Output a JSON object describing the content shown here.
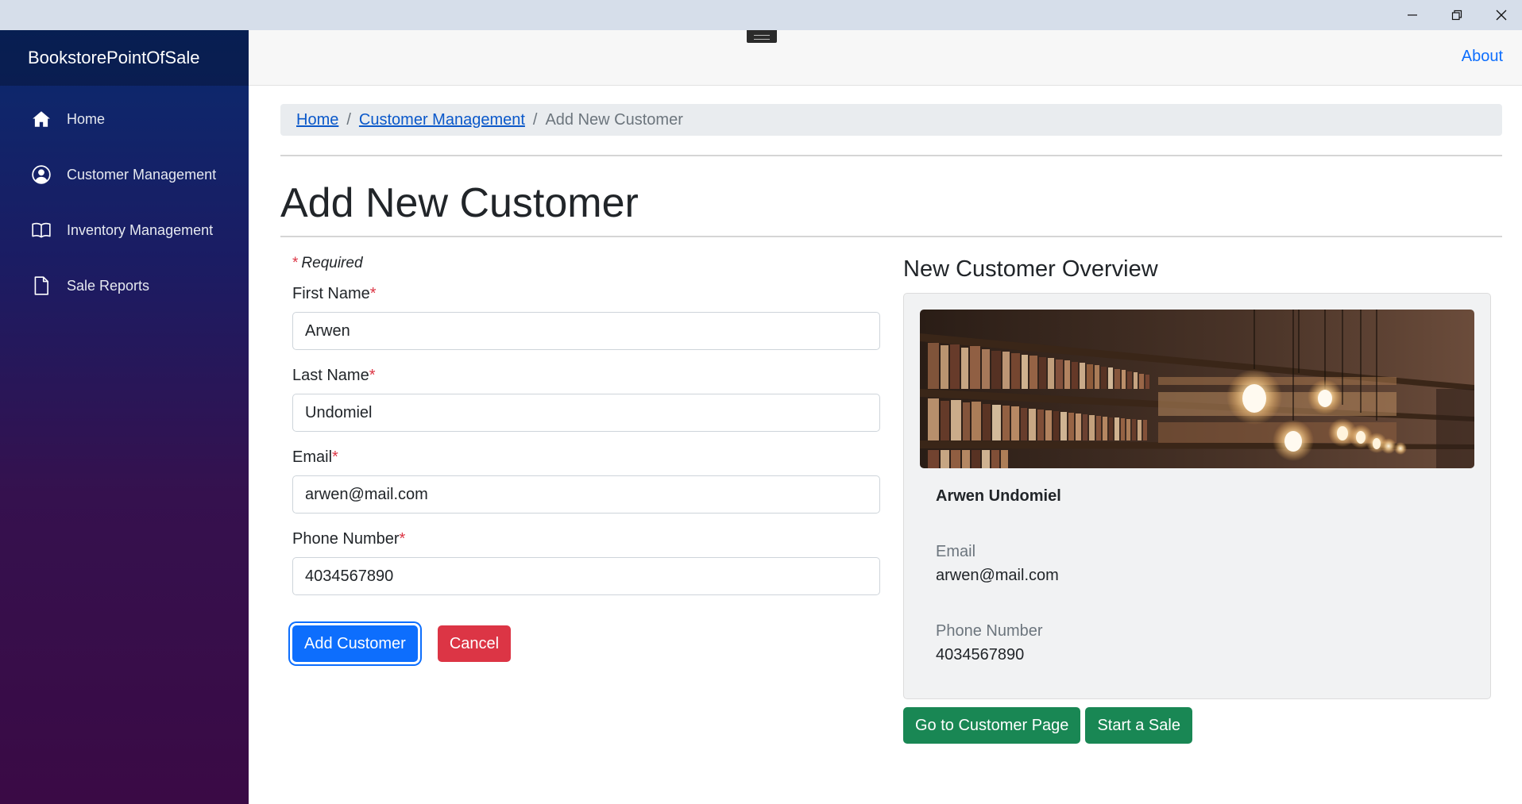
{
  "window": {
    "minimize_icon": "minimize-icon",
    "restore_icon": "restore-icon",
    "close_icon": "close-icon"
  },
  "sidebar": {
    "brand": "BookstorePointOfSale",
    "items": [
      {
        "label": "Home",
        "icon": "home-icon"
      },
      {
        "label": "Customer Management",
        "icon": "user-circle-icon"
      },
      {
        "label": "Inventory Management",
        "icon": "book-icon"
      },
      {
        "label": "Sale Reports",
        "icon": "file-icon"
      }
    ]
  },
  "topbar": {
    "about": "About"
  },
  "breadcrumb": {
    "items": [
      "Home",
      "Customer Management"
    ],
    "current": "Add New Customer",
    "separator": "/"
  },
  "page": {
    "title": "Add New Customer"
  },
  "form": {
    "required_star": "*",
    "required_note": "Required",
    "fields": [
      {
        "label": "First Name",
        "value": "Arwen"
      },
      {
        "label": "Last Name",
        "value": "Undomiel"
      },
      {
        "label": "Email",
        "value": "arwen@mail.com"
      },
      {
        "label": "Phone Number",
        "value": "4034567890"
      }
    ],
    "submit": "Add Customer",
    "cancel": "Cancel"
  },
  "overview": {
    "title": "New Customer Overview",
    "image_icon": "bookshelf-image",
    "name": "Arwen Undomiel",
    "email_label": "Email",
    "email_value": "arwen@mail.com",
    "phone_label": "Phone Number",
    "phone_value": "4034567890",
    "goto_button": "Go to Customer Page",
    "sale_button": "Start a Sale"
  },
  "colors": {
    "primary": "#0d6efd",
    "danger": "#dc3545",
    "success": "#198754",
    "sidebar_top": "#0a2a6e",
    "sidebar_bottom": "#3a0a45"
  }
}
